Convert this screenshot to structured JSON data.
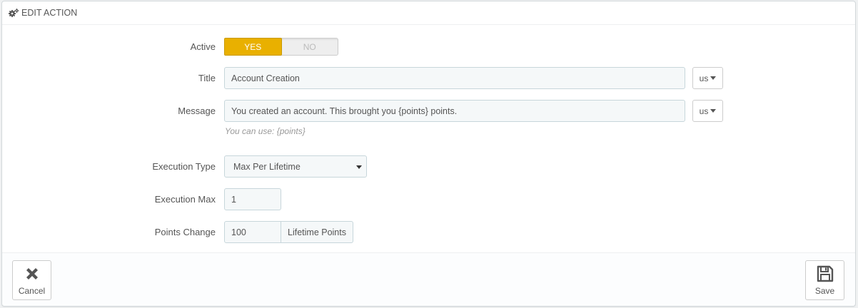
{
  "panel": {
    "title": "EDIT ACTION",
    "icon": "cogs-icon"
  },
  "form": {
    "active": {
      "label": "Active",
      "yes_label": "YES",
      "no_label": "NO",
      "value": "YES"
    },
    "title": {
      "label": "Title",
      "value": "Account Creation",
      "language": "us"
    },
    "message": {
      "label": "Message",
      "value": "You created an account. This brought you {points} points.",
      "language": "us",
      "help": "You can use: {points}"
    },
    "execution_type": {
      "label": "Execution Type",
      "selected": "Max Per Lifetime"
    },
    "execution_max": {
      "label": "Execution Max",
      "value": "1"
    },
    "points_change": {
      "label": "Points Change",
      "value": "100",
      "addon": "Lifetime Points"
    }
  },
  "footer": {
    "cancel_label": "Cancel",
    "cancel_icon": "close-icon",
    "save_label": "Save",
    "save_icon": "floppy-disk-icon"
  },
  "colors": {
    "accent": "#e9b000",
    "input_bg": "#f5f8f9",
    "input_border": "#c7d6db"
  }
}
